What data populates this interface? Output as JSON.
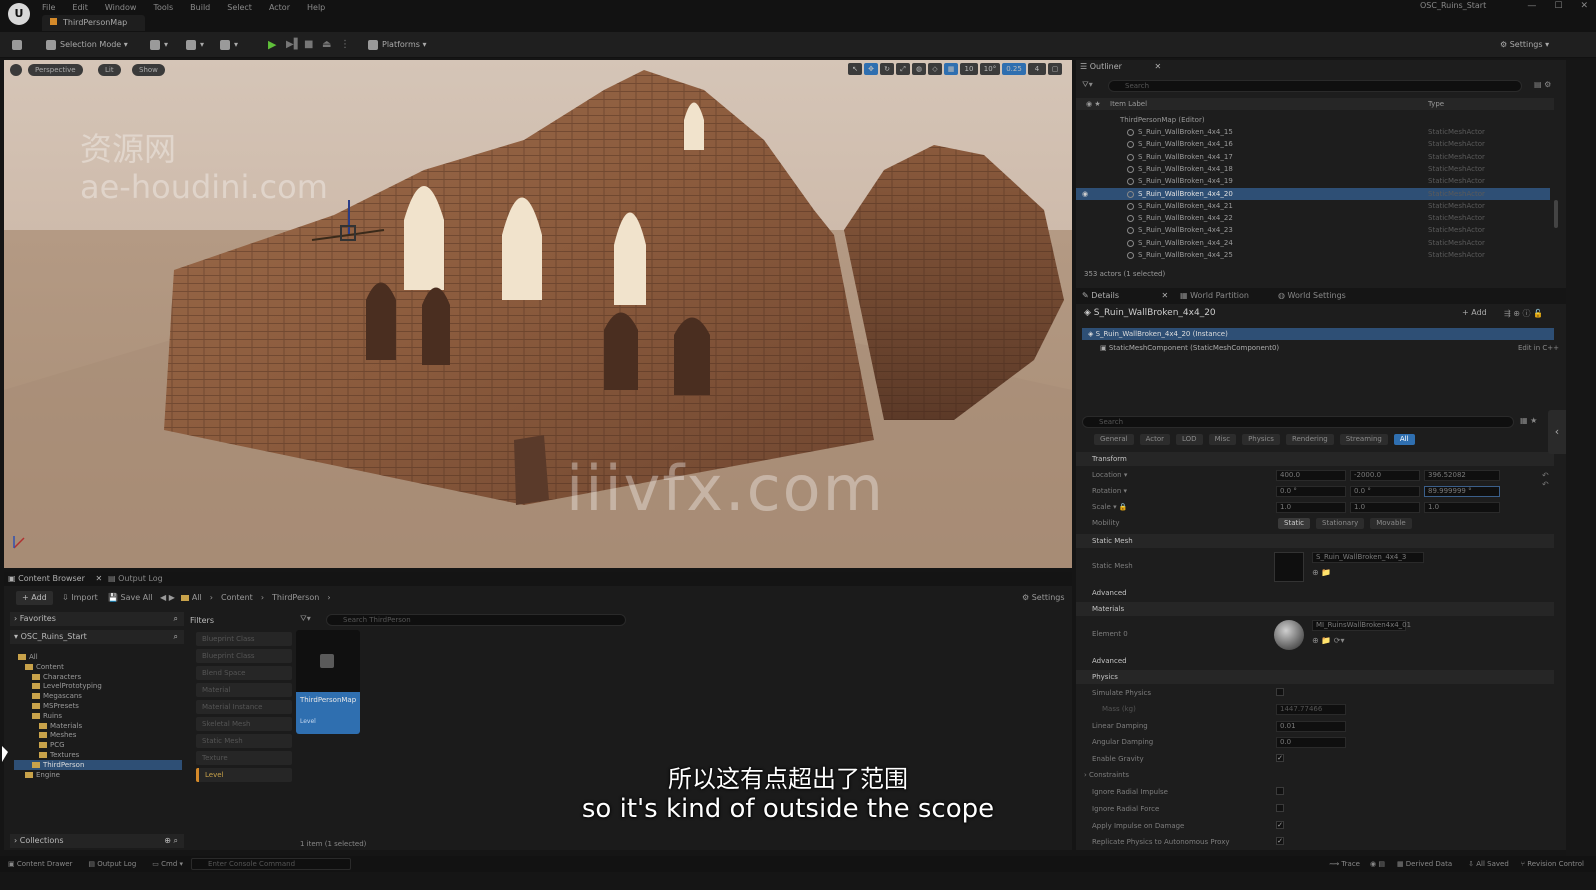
{
  "menubar": {
    "items": [
      "File",
      "Edit",
      "Window",
      "Tools",
      "Build",
      "Select",
      "Actor",
      "Help"
    ],
    "project": "OSC_Ruins_Start"
  },
  "tab": {
    "map": "ThirdPersonMap"
  },
  "toolbar": {
    "selection_mode": "Selection Mode",
    "platforms": "Platforms",
    "settings": "Settings"
  },
  "viewport": {
    "perspective": "Perspective",
    "lit": "Lit",
    "show": "Show",
    "tools": [
      "1",
      "10",
      "10°",
      "0.25",
      "4"
    ]
  },
  "outliner": {
    "tab": "Outliner",
    "search_placeholder": "Search",
    "col_label": "Item Label",
    "col_type": "Type",
    "root": "ThirdPersonMap (Editor)",
    "rows": [
      {
        "name": "S_Ruin_WallBroken_4x4_15",
        "type": "StaticMeshActor",
        "selected": false
      },
      {
        "name": "S_Ruin_WallBroken_4x4_16",
        "type": "StaticMeshActor",
        "selected": false
      },
      {
        "name": "S_Ruin_WallBroken_4x4_17",
        "type": "StaticMeshActor",
        "selected": false
      },
      {
        "name": "S_Ruin_WallBroken_4x4_18",
        "type": "StaticMeshActor",
        "selected": false
      },
      {
        "name": "S_Ruin_WallBroken_4x4_19",
        "type": "StaticMeshActor",
        "selected": false
      },
      {
        "name": "S_Ruin_WallBroken_4x4_20",
        "type": "StaticMeshActor",
        "selected": true
      },
      {
        "name": "S_Ruin_WallBroken_4x4_21",
        "type": "StaticMeshActor",
        "selected": false
      },
      {
        "name": "S_Ruin_WallBroken_4x4_22",
        "type": "StaticMeshActor",
        "selected": false
      },
      {
        "name": "S_Ruin_WallBroken_4x4_23",
        "type": "StaticMeshActor",
        "selected": false
      },
      {
        "name": "S_Ruin_WallBroken_4x4_24",
        "type": "StaticMeshActor",
        "selected": false
      },
      {
        "name": "S_Ruin_WallBroken_4x4_25",
        "type": "StaticMeshActor",
        "selected": false
      }
    ],
    "status": "353 actors (1 selected)"
  },
  "details": {
    "tabs": [
      "Details",
      "World Partition",
      "World Settings"
    ],
    "actor_name": "S_Ruin_WallBroken_4x4_20",
    "add_label": "Add",
    "instance": "S_Ruin_WallBroken_4x4_20 (Instance)",
    "component": "StaticMeshComponent (StaticMeshComponent0)",
    "edit_cpp": "Edit in C++",
    "search_placeholder": "Search",
    "filters": [
      "General",
      "Actor",
      "LOD",
      "Misc",
      "Physics",
      "Rendering",
      "Streaming",
      "All"
    ],
    "transform": {
      "section": "Transform",
      "location_label": "Location",
      "rotation_label": "Rotation",
      "scale_label": "Scale",
      "location": [
        "400.0",
        "-2000.0",
        "396.52082"
      ],
      "rotation": [
        "0.0 °",
        "0.0 °",
        "89.999999 °"
      ],
      "scale": [
        "1.0",
        "1.0",
        "1.0"
      ],
      "mobility_label": "Mobility",
      "mobility": [
        "Static",
        "Stationary",
        "Movable"
      ]
    },
    "static_mesh": {
      "section": "Static Mesh",
      "label": "Static Mesh",
      "value": "S_Ruin_WallBroken_4x4_3"
    },
    "advanced": "Advanced",
    "materials": {
      "section": "Materials",
      "label": "Element 0",
      "value": "MI_RuinsWallBroken4x4_01"
    },
    "physics": {
      "section": "Physics",
      "simulate": "Simulate Physics",
      "mass": "Mass (kg)",
      "mass_value": "1447.77466",
      "linear_damping": "Linear Damping",
      "linear_damping_value": "0.01",
      "angular_damping": "Angular Damping",
      "angular_damping_value": "0.0",
      "enable_gravity": "Enable Gravity",
      "constraints": "Constraints",
      "ignore_radial_impulse": "Ignore Radial Impulse",
      "ignore_radial_force": "Ignore Radial Force",
      "apply_impulse": "Apply Impulse on Damage",
      "replicate": "Replicate Physics to Autonomous Proxy"
    }
  },
  "content_browser": {
    "tabs": [
      "Content Browser",
      "Output Log"
    ],
    "add": "Add",
    "import": "Import",
    "save_all": "Save All",
    "breadcrumb": [
      "All",
      "Content",
      "ThirdPerson"
    ],
    "settings": "Settings",
    "favorites": "Favorites",
    "project": "OSC_Ruins_Start",
    "filters_title": "Filters",
    "filters": [
      "Blueprint Class",
      "Blueprint Class",
      "Blend Space",
      "Material",
      "Material Instance",
      "Skeletal Mesh",
      "Static Mesh",
      "Texture"
    ],
    "level_filter": "Level",
    "search_placeholder": "Search ThirdPerson",
    "tree": [
      {
        "label": "All",
        "depth": 0,
        "selected": false
      },
      {
        "label": "Content",
        "depth": 1,
        "selected": false
      },
      {
        "label": "Characters",
        "depth": 2,
        "selected": false
      },
      {
        "label": "LevelPrototyping",
        "depth": 2,
        "selected": false
      },
      {
        "label": "Megascans",
        "depth": 2,
        "selected": false
      },
      {
        "label": "MSPresets",
        "depth": 2,
        "selected": false
      },
      {
        "label": "Ruins",
        "depth": 2,
        "selected": false
      },
      {
        "label": "Materials",
        "depth": 3,
        "selected": false
      },
      {
        "label": "Meshes",
        "depth": 3,
        "selected": false
      },
      {
        "label": "PCG",
        "depth": 3,
        "selected": false
      },
      {
        "label": "Textures",
        "depth": 3,
        "selected": false
      },
      {
        "label": "ThirdPerson",
        "depth": 2,
        "selected": true
      },
      {
        "label": "Engine",
        "depth": 1,
        "selected": false
      }
    ],
    "asset_name": "ThirdPersonMap",
    "asset_type": "Level",
    "item_count": "1 item (1 selected)",
    "collections": "Collections"
  },
  "statusbar": {
    "content_drawer": "Content Drawer",
    "output_log": "Output Log",
    "cmd": "Cmd",
    "cmd_placeholder": "Enter Console Command",
    "trace": "Trace",
    "derived_data": "Derived Data",
    "all_saved": "All Saved",
    "revision_control": "Revision Control"
  },
  "watermarks": {
    "cn": "资源网",
    "site1": "ae-houdini.com",
    "site2": "iiivfx.com"
  },
  "subtitles": {
    "zh": "所以这有点超出了范围",
    "en": "so it's kind of outside the scope"
  },
  "colors": {
    "accent": "#2f6fb0",
    "selected_row": "#2e4f75",
    "play": "#5fbf3a",
    "folder": "#c8a24a"
  }
}
